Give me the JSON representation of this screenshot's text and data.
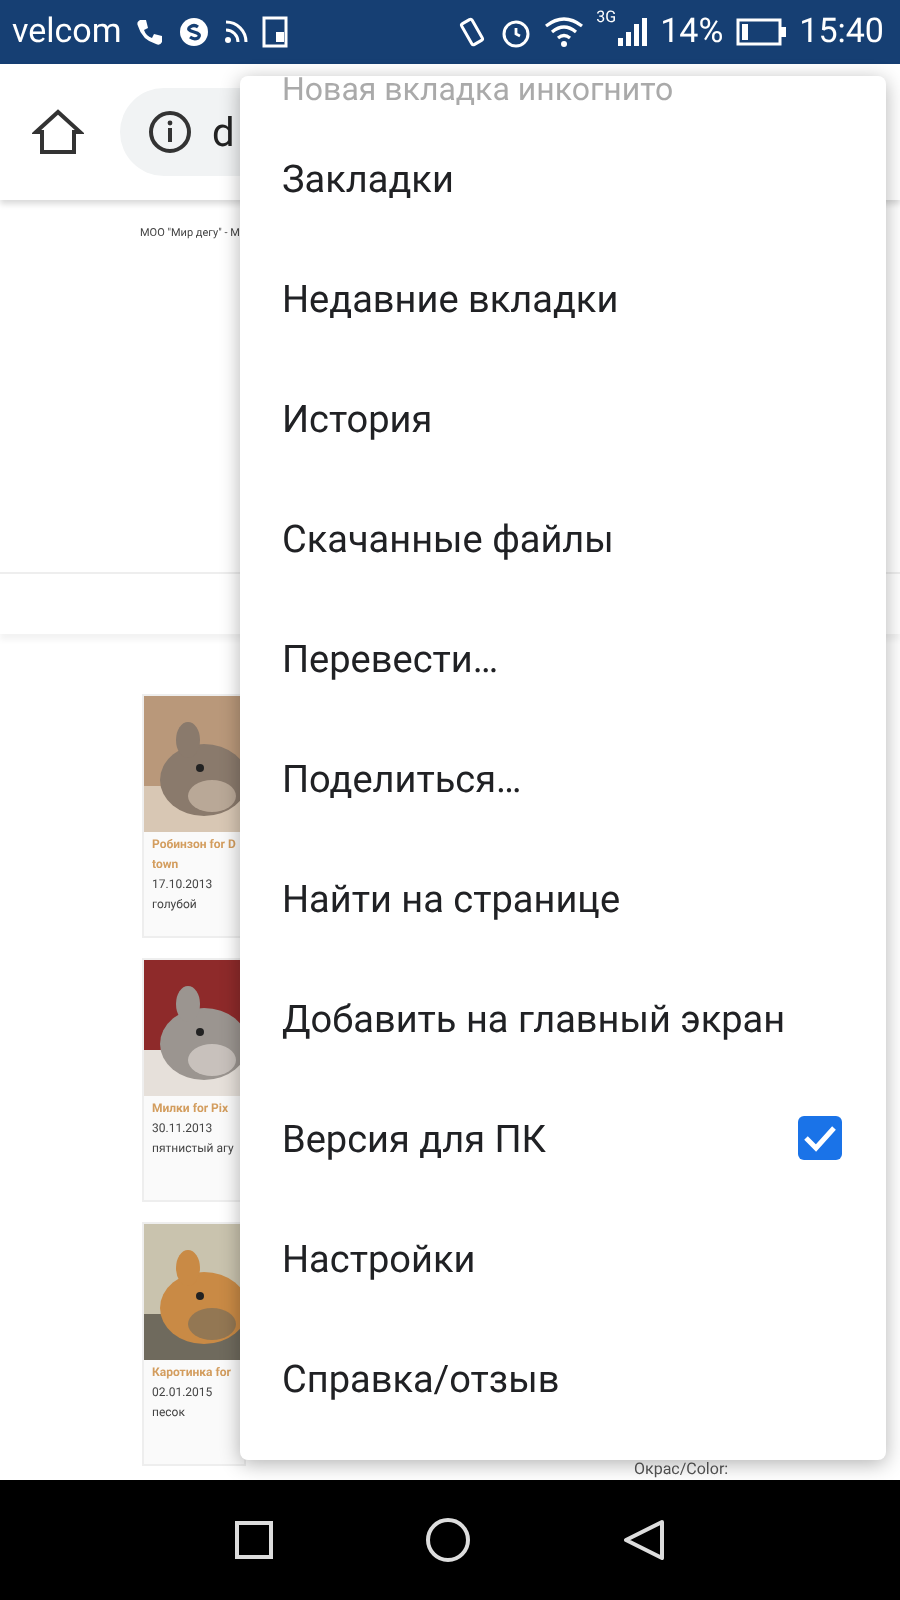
{
  "status_bar": {
    "carrier": "velcom",
    "network": "3G",
    "battery": "14%",
    "time": "15:40"
  },
  "toolbar": {
    "address": "d"
  },
  "page": {
    "header": "МОО \"Мир дегу\" - М",
    "cards": [
      {
        "name": "Робинзон for D",
        "name_2": "town",
        "date": "17.10.2013",
        "coat": "голубой"
      },
      {
        "name": "Милки for Pix",
        "date": "30.11.2013",
        "coat": "пятнистый агу"
      },
      {
        "name": "Каротинка for",
        "date": "02.01.2015",
        "coat": "песок"
      }
    ],
    "footer_label": "Окрас/Color:"
  },
  "menu": {
    "partial_item": "Новая вкладка инкогнито",
    "items": [
      {
        "label": "Закладки",
        "kind": "plain"
      },
      {
        "label": "Недавние вкладки",
        "kind": "plain"
      },
      {
        "label": "История",
        "kind": "plain"
      },
      {
        "label": "Скачанные файлы",
        "kind": "plain"
      },
      {
        "label": "Перевести…",
        "kind": "plain"
      },
      {
        "label": "Поделиться…",
        "kind": "plain"
      },
      {
        "label": "Найти на странице",
        "kind": "plain"
      },
      {
        "label": "Добавить на главный экран",
        "kind": "plain"
      },
      {
        "label": "Версия для ПК",
        "kind": "checkbox",
        "checked": true
      },
      {
        "label": "Настройки",
        "kind": "plain"
      },
      {
        "label": "Справка/отзыв",
        "kind": "plain"
      }
    ]
  }
}
